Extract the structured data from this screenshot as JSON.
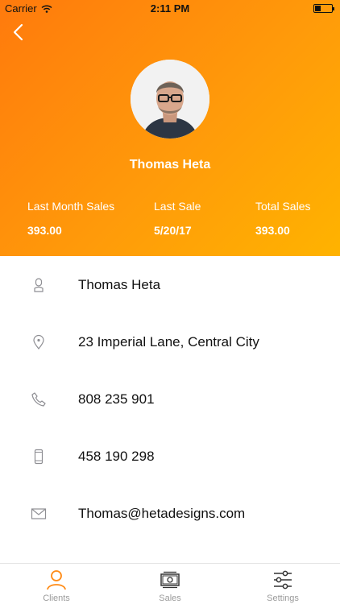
{
  "status_bar": {
    "carrier": "Carrier",
    "time": "2:11 PM"
  },
  "profile": {
    "name": "Thomas Heta"
  },
  "stats": [
    {
      "label": "Last Month Sales",
      "value": "393.00"
    },
    {
      "label": "Last Sale",
      "value": "5/20/17"
    },
    {
      "label": "Total Sales",
      "value": "393.00"
    }
  ],
  "details": {
    "name": "Thomas Heta",
    "address": "23 Imperial Lane, Central City",
    "phone": "808 235 901",
    "mobile": "458 190 298",
    "email": "Thomas@hetadesigns.com"
  },
  "tabs": [
    {
      "label": "Clients",
      "icon": "person-icon"
    },
    {
      "label": "Sales",
      "icon": "cash-icon"
    },
    {
      "label": "Settings",
      "icon": "sliders-icon"
    }
  ],
  "colors": {
    "gradient_start": "#ff7a0d",
    "gradient_end": "#ffb300",
    "active_tab": "#ff8a14"
  }
}
